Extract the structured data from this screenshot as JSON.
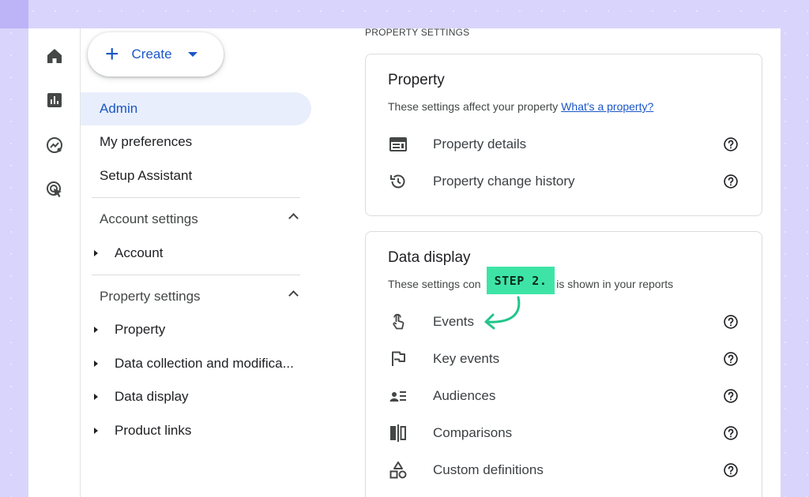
{
  "colors": {
    "background": "#d9d4fb",
    "accent": "#1a56c7",
    "step_badge": "#3ee4a6"
  },
  "rail": {
    "icons": [
      "home-icon",
      "reports-icon",
      "explore-icon",
      "advertising-icon"
    ]
  },
  "nav": {
    "create_label": "Create",
    "admin_label": "Admin",
    "preferences_label": "My preferences",
    "setup_label": "Setup Assistant",
    "account_settings": {
      "label": "Account settings",
      "items": [
        "Account"
      ]
    },
    "property_settings": {
      "label": "Property settings",
      "items": [
        "Property",
        "Data collection and modifica...",
        "Data display",
        "Product links"
      ]
    }
  },
  "main": {
    "heading": "PROPERTY SETTINGS",
    "property_card": {
      "title": "Property",
      "subtitle": "These settings affect your property",
      "link": "What's a property?",
      "rows": [
        {
          "label": "Property details",
          "icon": "property-details-icon"
        },
        {
          "label": "Property change history",
          "icon": "history-icon"
        }
      ]
    },
    "data_display_card": {
      "title": "Data display",
      "subtitle_start": "These settings con",
      "subtitle_end": "is shown in your reports",
      "rows": [
        {
          "label": "Events",
          "icon": "touch-icon"
        },
        {
          "label": "Key events",
          "icon": "flag-icon"
        },
        {
          "label": "Audiences",
          "icon": "audiences-icon"
        },
        {
          "label": "Comparisons",
          "icon": "comparisons-icon"
        },
        {
          "label": "Custom definitions",
          "icon": "shapes-icon"
        }
      ]
    }
  },
  "annotation": {
    "step_label": "STEP 2."
  }
}
